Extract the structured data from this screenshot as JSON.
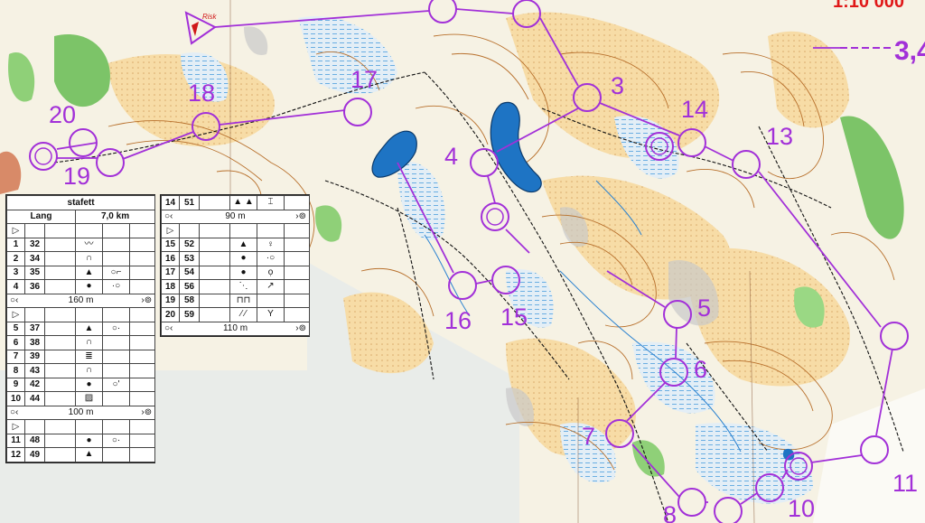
{
  "map": {
    "scale_label": "1:10 000",
    "start_label": "Risk",
    "partial_course_label": "3,4",
    "colors": {
      "course": "#a230d8",
      "water": "#1e74c4",
      "open_land": "#f3cf8a",
      "forest_green": "#72c060",
      "contour": "#b8702c",
      "marsh": "#7db8e6",
      "background": "#f4f1e6"
    },
    "controls": [
      {
        "label": "3"
      },
      {
        "label": "4"
      },
      {
        "label": "5"
      },
      {
        "label": "6"
      },
      {
        "label": "7"
      },
      {
        "label": "8"
      },
      {
        "label": "10"
      },
      {
        "label": "11"
      },
      {
        "label": "13"
      },
      {
        "label": "14"
      },
      {
        "label": "15"
      },
      {
        "label": "16"
      },
      {
        "label": "17"
      },
      {
        "label": "18"
      },
      {
        "label": "19"
      },
      {
        "label": "20"
      }
    ]
  },
  "description_left": {
    "title": "stafett",
    "class_name": "Lang",
    "length": "7,0 km",
    "start_symbol": "▷",
    "rows_a": [
      {
        "num": "1",
        "code": "32",
        "feature": "〰",
        "extra": ""
      },
      {
        "num": "2",
        "code": "34",
        "feature": "∩",
        "extra": ""
      },
      {
        "num": "3",
        "code": "35",
        "feature": "▲",
        "extra": "○⌐"
      },
      {
        "num": "4",
        "code": "36",
        "feature": "●",
        "extra": "·○"
      }
    ],
    "marked_a": "160 m",
    "rows_b": [
      {
        "num": "5",
        "code": "37",
        "feature": "▲",
        "extra": "○·"
      },
      {
        "num": "6",
        "code": "38",
        "feature": "∩",
        "extra": ""
      },
      {
        "num": "7",
        "code": "39",
        "feature": "≣",
        "extra": ""
      },
      {
        "num": "8",
        "code": "43",
        "feature": "∩",
        "extra": ""
      },
      {
        "num": "9",
        "code": "42",
        "feature": "●",
        "extra": "○'"
      },
      {
        "num": "10",
        "code": "44",
        "feature": "▨",
        "extra": ""
      }
    ],
    "marked_b": "100 m",
    "rows_c": [
      {
        "num": "11",
        "code": "48",
        "feature": "●",
        "extra": "○·"
      },
      {
        "num": "12",
        "code": "49",
        "feature": "▲",
        "extra": ""
      }
    ]
  },
  "description_right": {
    "first_row": {
      "num": "14",
      "code": "51",
      "feature": "▲ ▲",
      "extra": "⌶"
    },
    "marked_a": "90 m",
    "start_symbol": "▷",
    "rows": [
      {
        "num": "15",
        "code": "52",
        "feature": "▲",
        "extra": "♀"
      },
      {
        "num": "16",
        "code": "53",
        "feature": "●",
        "extra": "·○"
      },
      {
        "num": "17",
        "code": "54",
        "feature": "●",
        "extra": "ọ"
      },
      {
        "num": "18",
        "code": "56",
        "feature": "⋱",
        "extra": "↗"
      },
      {
        "num": "19",
        "code": "58",
        "feature": "⊓⊓",
        "extra": ""
      },
      {
        "num": "20",
        "code": "59",
        "feature": "⁄ ⁄",
        "extra": "Y"
      }
    ],
    "marked_b": "110 m"
  }
}
